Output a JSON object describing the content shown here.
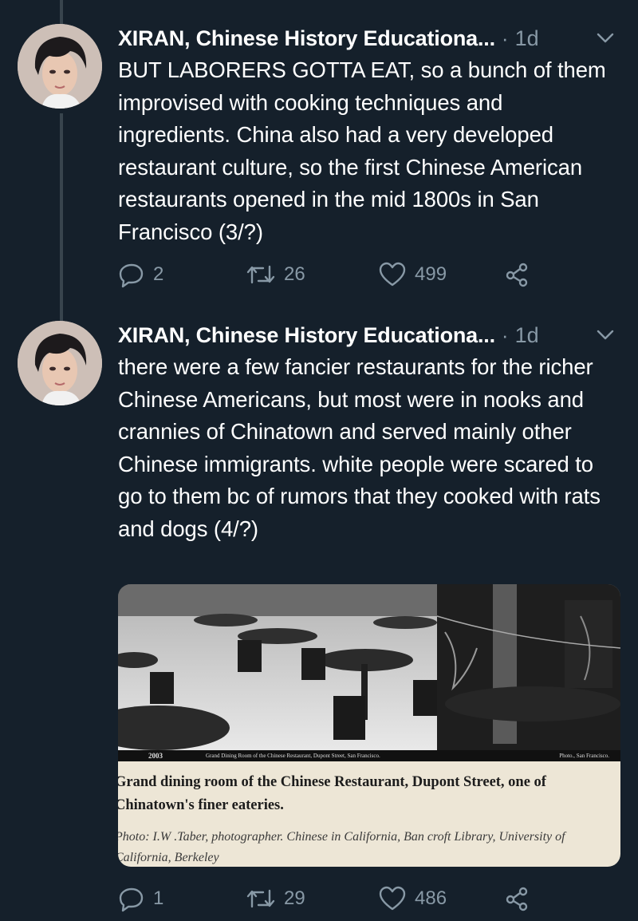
{
  "tweets": [
    {
      "author": "XIRAN, Chinese History Educationa...",
      "separator": "·",
      "time": "1d",
      "text": "BUT LABORERS GOTTA EAT, so a bunch of them improvised with cooking techniques and ingredients. China also had a very developed restaurant culture, so the first Chinese American restaurants opened in the mid 1800s in San Francisco (3/?)",
      "replies": "2",
      "retweets": "26",
      "likes": "499"
    },
    {
      "author": "XIRAN, Chinese History Educationa...",
      "separator": "·",
      "time": "1d",
      "text": "there were a few fancier restaurants for the richer Chinese Americans, but most were in nooks and crannies of Chinatown and served mainly other Chinese immigrants. white people were scared to go to them bc of rumors that they cooked with rats and dogs (4/?)",
      "replies": "1",
      "retweets": "29",
      "likes": "486",
      "media": {
        "photo_strip_number": "2003",
        "photo_strip_description": "Grand Dining Room of the Chinese Restaurant, Dupont Street, San Francisco.",
        "photo_strip_credit": "Photo., San Francisco.",
        "caption_title": "Grand dining room of the Chinese Restaurant, Dupont Street, one of Chinatown's finer eateries.",
        "caption_credit": "Photo: I.W .Taber, photographer. Chinese in California, Ban croft Library, University of California, Berkeley"
      }
    }
  ],
  "icons": {
    "reply": "reply-icon",
    "retweet": "retweet-icon",
    "like": "heart-icon",
    "share": "share-icon",
    "more": "chevron-down-icon"
  },
  "colors": {
    "background": "#15202b",
    "secondary_text": "#8899a6",
    "thread_line": "#38444d"
  }
}
